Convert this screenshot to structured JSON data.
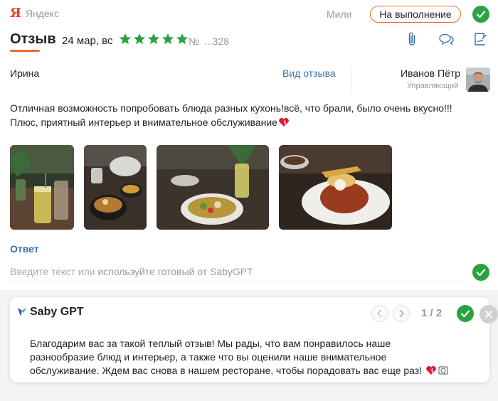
{
  "topbar": {
    "source_logo": "Я",
    "source_name": "Яндекс",
    "author": "Мили",
    "status_button": "На выполнение",
    "colors": {
      "accent": "#f06a2a",
      "success": "#2aa33f",
      "brand": "#fc3f1d"
    }
  },
  "header": {
    "title": "Отзыв",
    "date": "24 мар, вс",
    "rating": 5,
    "rating_max": 5,
    "number_label": "№",
    "number_value": "...328",
    "icons": [
      "paperclip-icon",
      "chat-bubbles-icon",
      "sign-document-icon"
    ]
  },
  "review": {
    "reviewer": "Ирина",
    "view_link": "Вид отзыва",
    "manager": {
      "name": "Иванов Пётр",
      "role": "Управляющий"
    },
    "text_line1": "Отличная возможность попробовать блюда разных кухонь!всё, что брали, было очень вкусно!!!",
    "text_line2": "Плюс, приятный интерьер и внимательное обслуживание",
    "photo_count": 4
  },
  "reply": {
    "title": "Ответ",
    "placeholder_prefix": "Введите текст или",
    "placeholder_link": "используйте готовый от SabyGPT"
  },
  "gpt": {
    "title": "Saby GPT",
    "page_counter": "1 / 2",
    "text_line1": "Благодарим вас за такой теплый отзыв! Мы рады, что вам понравилось наше",
    "text_line2": "разнообразие блюд и интерьер, а также что вы оценили наше внимательное",
    "text_line3": "обслуживание. Ждем вас снова в нашем ресторане, чтобы порадовать вас еще раз!"
  }
}
